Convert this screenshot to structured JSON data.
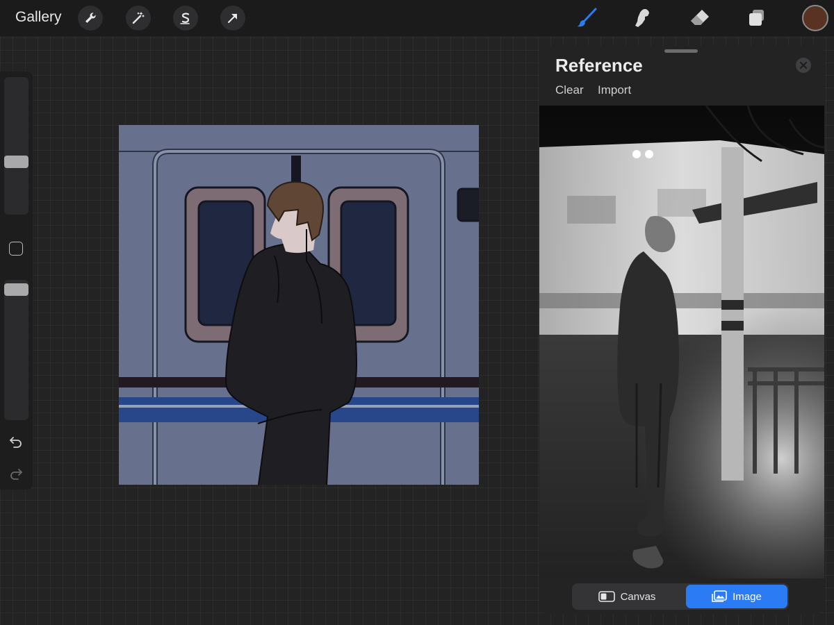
{
  "app": {
    "gallery_label": "Gallery"
  },
  "toolbar": {
    "left_tools": [
      {
        "name": "actions",
        "icon": "wrench-icon"
      },
      {
        "name": "adjustments",
        "icon": "magic-wand-icon"
      },
      {
        "name": "selection",
        "icon": "selection-s-icon"
      },
      {
        "name": "transform",
        "icon": "arrow-cursor-icon"
      }
    ],
    "right_tools": [
      {
        "name": "brush",
        "icon": "brush-icon",
        "active": true
      },
      {
        "name": "smudge",
        "icon": "smudge-icon"
      },
      {
        "name": "eraser",
        "icon": "eraser-icon"
      },
      {
        "name": "layers",
        "icon": "layers-icon"
      }
    ],
    "current_color": "#5a3224",
    "active_color": "#2a7bf4"
  },
  "sidebar": {
    "brush_size_level": 0.65,
    "opacity_level": 0.95
  },
  "reference": {
    "title": "Reference",
    "clear_label": "Clear",
    "import_label": "Import",
    "segments": {
      "canvas_label": "Canvas",
      "image_label": "Image",
      "selected": "Image"
    }
  }
}
